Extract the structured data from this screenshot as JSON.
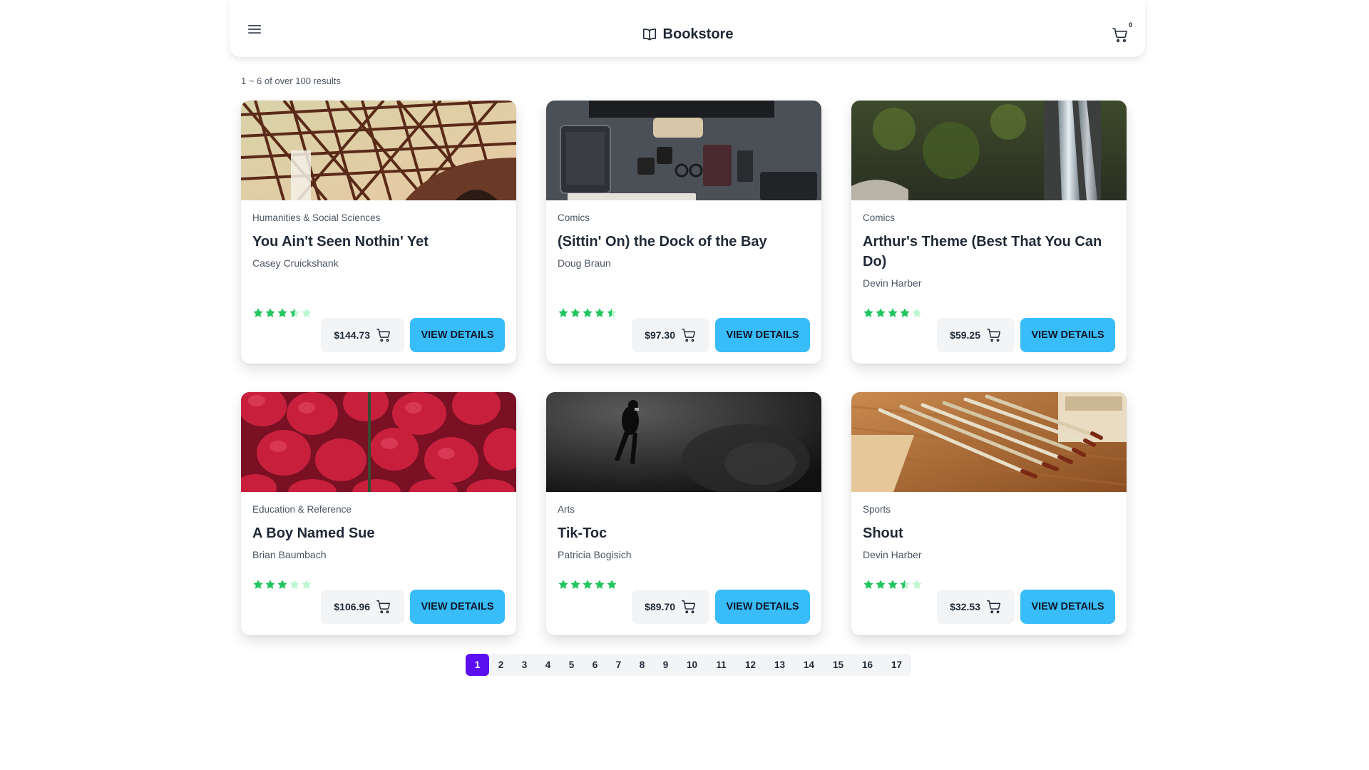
{
  "header": {
    "brand": "Bookstore",
    "cart_count": "0",
    "icons": {
      "menu": "menu-icon",
      "brand": "book-open-icon",
      "cart": "cart-icon"
    }
  },
  "results_text": "1 ~ 6 of over 100 results",
  "colors": {
    "primary_button": "#38bdf8",
    "active_page": "#5b0ff0",
    "star_filled": "#22c55e",
    "star_empty": "#bbf7d0"
  },
  "books": [
    {
      "category": "Humanities & Social Sciences",
      "title": "You Ain't Seen Nothin' Yet",
      "author": "Casey Cruickshank",
      "rating": 3.5,
      "price": "$144.73",
      "details_label": "VIEW DETAILS",
      "image": "steel-bridge-photo"
    },
    {
      "category": "Comics",
      "title": "(Sittin' On) the Dock of the Bay",
      "author": "Doug Braun",
      "rating": 4.5,
      "price": "$97.30",
      "details_label": "VIEW DETAILS",
      "image": "desk-gadgets-photo"
    },
    {
      "category": "Comics",
      "title": "Arthur's Theme (Best That You Can Do)",
      "author": "Devin Harber",
      "rating": 4,
      "price": "$59.25",
      "details_label": "VIEW DETAILS",
      "image": "waterfall-photo"
    },
    {
      "category": "Education & Reference",
      "title": "A Boy Named Sue",
      "author": "Brian Baumbach",
      "rating": 3,
      "price": "$106.96",
      "details_label": "VIEW DETAILS",
      "image": "strawberries-photo"
    },
    {
      "category": "Arts",
      "title": "Tik-Toc",
      "author": "Patricia Bogisich",
      "rating": 5,
      "price": "$89.70",
      "details_label": "VIEW DETAILS",
      "image": "diver-photo"
    },
    {
      "category": "Sports",
      "title": "Shout",
      "author": "Devin Harber",
      "rating": 3.5,
      "price": "$32.53",
      "details_label": "VIEW DETAILS",
      "image": "paint-brushes-photo"
    }
  ],
  "pagination": {
    "current": "1",
    "pages": [
      "1",
      "2",
      "3",
      "4",
      "5",
      "6",
      "7",
      "8",
      "9",
      "10",
      "11",
      "12",
      "13",
      "14",
      "15",
      "16",
      "17"
    ]
  }
}
